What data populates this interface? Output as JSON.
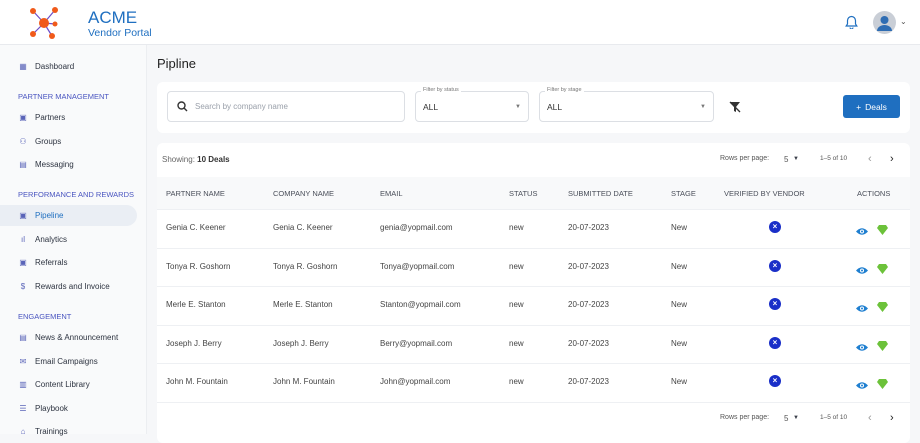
{
  "header": {
    "brand": "ACME",
    "subtitle": "Vendor Portal"
  },
  "sidebar": {
    "dashboard": "Dashboard",
    "sections": [
      {
        "title": "PARTNER MANAGEMENT",
        "items": [
          "Partners",
          "Groups",
          "Messaging"
        ]
      },
      {
        "title": "PERFORMANCE AND REWARDS",
        "items": [
          "Pipeline",
          "Analytics",
          "Referrals",
          "Rewards and Invoice"
        ]
      },
      {
        "title": "ENGAGEMENT",
        "items": [
          "News & Announcement",
          "Email Campaigns",
          "Content Library",
          "Playbook",
          "Trainings"
        ]
      }
    ],
    "active": "Pipeline"
  },
  "page": {
    "title": "Pipline"
  },
  "filters": {
    "search_placeholder": "Search by company name",
    "status_label": "Filter by status",
    "status_value": "ALL",
    "stage_label": "Filter by stage",
    "stage_value": "ALL",
    "add_button": "Deals"
  },
  "table": {
    "showing_label": "Showing:",
    "showing_value": "10 Deals",
    "rows_per_page_label": "Rows per page:",
    "rows_per_page": "5",
    "range": "1–5 of 10",
    "columns": [
      "PARTNER NAME",
      "COMPANY NAME",
      "EMAIL",
      "STATUS",
      "SUBMITTED DATE",
      "STAGE",
      "VERIFIED BY VENDOR",
      "ACTIONS"
    ],
    "rows": [
      {
        "partner": "Genia C. Keener",
        "company": "Genia C. Keener",
        "email": "genia@yopmail.com",
        "status": "new",
        "date": "20-07-2023",
        "stage": "New"
      },
      {
        "partner": "Tonya R. Goshorn",
        "company": "Tonya R. Goshorn",
        "email": "Tonya@yopmail.com",
        "status": "new",
        "date": "20-07-2023",
        "stage": "New"
      },
      {
        "partner": "Merle E. Stanton",
        "company": "Merle E. Stanton",
        "email": "Stanton@yopmail.com",
        "status": "new",
        "date": "20-07-2023",
        "stage": "New"
      },
      {
        "partner": "Joseph J. Berry",
        "company": "Joseph J. Berry",
        "email": "Berry@yopmail.com",
        "status": "new",
        "date": "20-07-2023",
        "stage": "New"
      },
      {
        "partner": "John M. Fountain",
        "company": "John M. Fountain",
        "email": "John@yopmail.com",
        "status": "new",
        "date": "20-07-2023",
        "stage": "New"
      }
    ]
  },
  "colors": {
    "accent": "#1f6fc0",
    "logo": "#f05a1a",
    "verified_x": "#1a2fc8",
    "gem": "#6cc23a"
  }
}
